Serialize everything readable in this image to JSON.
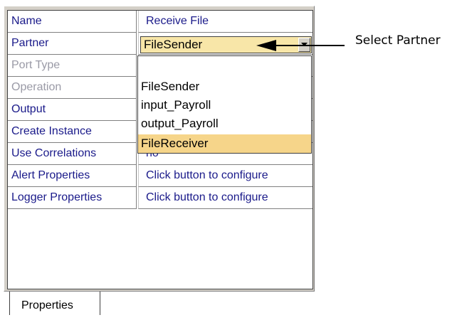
{
  "properties": {
    "rows": [
      {
        "name": "Name",
        "value": "Receive File",
        "enabled": true
      },
      {
        "name": "Partner",
        "value": "FileSender",
        "enabled": true
      },
      {
        "name": "Port Type",
        "value": "",
        "enabled": false
      },
      {
        "name": "Operation",
        "value": "",
        "enabled": false
      },
      {
        "name": "Output",
        "value": "",
        "enabled": true
      },
      {
        "name": "Create Instance",
        "value": "",
        "enabled": true
      },
      {
        "name": "Use Correlations",
        "value": "no",
        "enabled": true
      },
      {
        "name": "Alert Properties",
        "value": "Click button to configure",
        "enabled": true
      },
      {
        "name": "Logger Properties",
        "value": "Click button to configure",
        "enabled": true
      }
    ]
  },
  "partner_combo": {
    "selected_value": "FileSender",
    "options": [
      "FileSender",
      "input_Payroll",
      "output_Payroll",
      "FileReceiver"
    ],
    "highlighted_option": "FileReceiver"
  },
  "tabs": [
    {
      "label": "Properties"
    }
  ],
  "callout": {
    "label": "Select Partner"
  },
  "colors": {
    "panel_bg": "#d4d0c8",
    "label_text": "#1a1a8a",
    "disabled_text": "#9a9aa6",
    "combo_bg": "#f8e6a8",
    "highlight_bg": "#f6d58a"
  }
}
